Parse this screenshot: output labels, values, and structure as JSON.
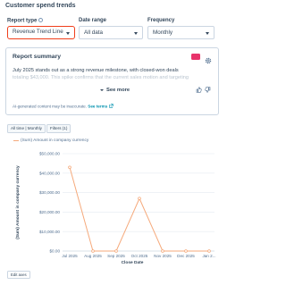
{
  "header": {
    "title": "Customer spend trends"
  },
  "controls": {
    "report_type": {
      "label": "Report type",
      "value": "Revenue Trend Line"
    },
    "date_range": {
      "label": "Date range",
      "value": "All data"
    },
    "frequency": {
      "label": "Frequency",
      "value": "Monthly"
    }
  },
  "summary": {
    "title": "Report summary",
    "text_line1": "July 2025 stands out as a strong revenue milestone, with closed-won deals",
    "text_line2": "totaling $43,000. This spike confirms that the current sales motion and targeting",
    "see_more": "See more",
    "disclaimer": "AI-generated content may be inaccurate.",
    "disclaimer_link": "See terms"
  },
  "filters": {
    "timeframe_chip": "All time | Monthly",
    "filters_chip": "Filters (1)"
  },
  "legend": {
    "series_name": "(Sum) Amount in company currency"
  },
  "colors": {
    "accent": "#f03e1b",
    "series": "#f5a97b",
    "ai_badge": "#e8336b"
  },
  "chart_data": {
    "type": "line",
    "x": [
      "Jul 2025",
      "Aug 2025",
      "Sep 2025",
      "Oct 2025",
      "Nov 2025",
      "Dec 2025",
      "Jan 2..."
    ],
    "series": [
      {
        "name": "(Sum) Amount in company currency",
        "values": [
          43000,
          0,
          0,
          27000,
          0,
          0,
          0
        ]
      }
    ],
    "xlabel": "Close Date",
    "ylabel": "(Sum) Amount in company currency",
    "ylim": [
      0,
      50000
    ],
    "yticks": [
      "$0.00",
      "$10,000.00",
      "$20,000.00",
      "$30,000.00",
      "$40,000.00",
      "$50,000.00"
    ],
    "grid": true
  },
  "footer": {
    "edit_button": "Edit axes"
  }
}
